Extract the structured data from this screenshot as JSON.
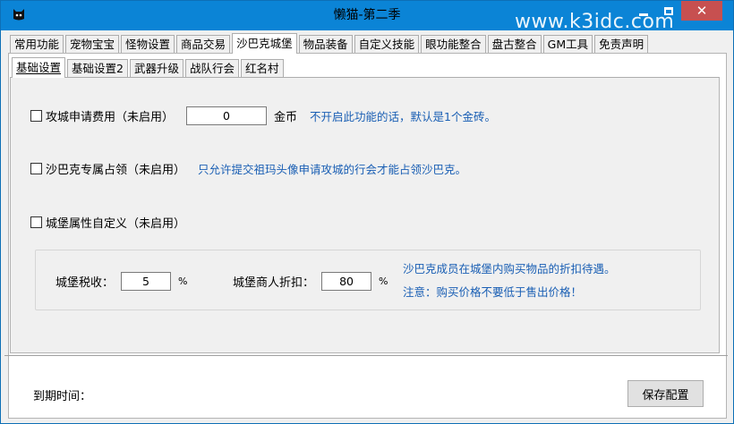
{
  "window": {
    "title": "懒猫-第二季",
    "watermark": "www.k3idc.com",
    "close_glyph": "✕"
  },
  "tabs_top": [
    {
      "label": "常用功能"
    },
    {
      "label": "宠物宝宝"
    },
    {
      "label": "怪物设置"
    },
    {
      "label": "商品交易"
    },
    {
      "label": "沙巴克城堡",
      "active": true
    },
    {
      "label": "物品装备"
    },
    {
      "label": "自定义技能"
    },
    {
      "label": "眼功能整合"
    },
    {
      "label": "盘古整合"
    },
    {
      "label": "GM工具"
    },
    {
      "label": "免责声明"
    }
  ],
  "tabs_sub": [
    {
      "label": "基础设置",
      "active": true
    },
    {
      "label": "基础设置2"
    },
    {
      "label": "武器升级"
    },
    {
      "label": "战队行会"
    },
    {
      "label": "红名村"
    }
  ],
  "siege_fee": {
    "label": "攻城申请费用（未启用）",
    "value": "0",
    "unit": "金币",
    "hint": "不开启此功能的话，默认是1个金砖。"
  },
  "exclusive": {
    "label": "沙巴克专属占领（未启用）",
    "hint": "只允许提交祖玛头像申请攻城的行会才能占领沙巴克。"
  },
  "custom_attr": {
    "label": "城堡属性自定义（未启用）"
  },
  "tax": {
    "tax_label": "城堡税收：",
    "tax_value": "5",
    "tax_unit": "%",
    "discount_label": "城堡商人折扣：",
    "discount_value": "80",
    "discount_unit": "%",
    "hint1": "沙巴克成员在城堡内购买物品的折扣待遇。",
    "hint2": "注意：购买价格不要低于售出价格！"
  },
  "footer": {
    "expire_label": "到期时间：",
    "save_label": "保存配置"
  }
}
